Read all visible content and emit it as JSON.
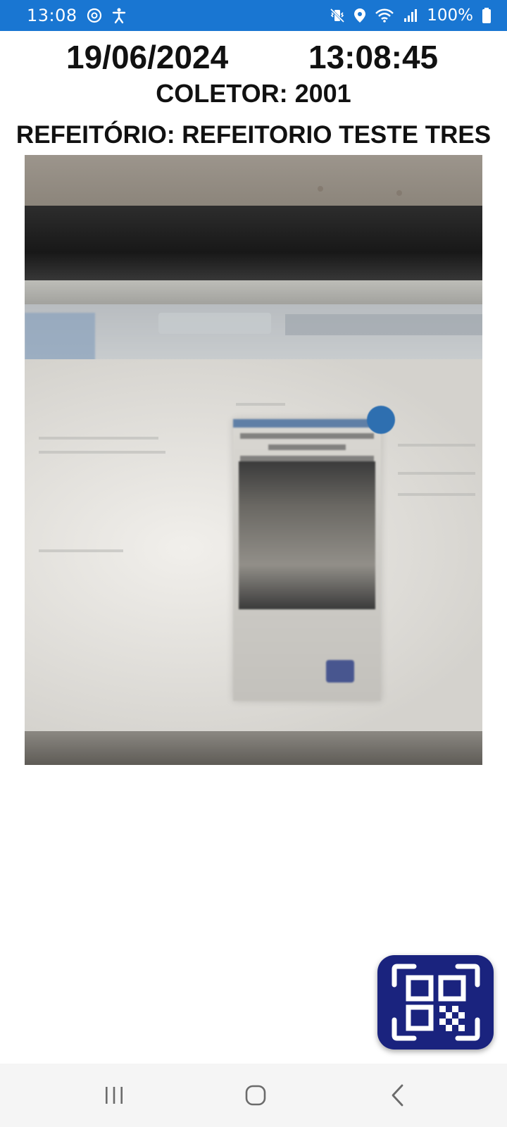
{
  "status_bar": {
    "time": "13:08",
    "battery": "100%",
    "background_color": "#1976d2",
    "icons_left": [
      "sync-icon",
      "accessibility-icon"
    ],
    "icons_right": [
      "vibrate-icon",
      "location-icon",
      "wifi-icon",
      "signal-icon",
      "battery-icon"
    ]
  },
  "header": {
    "date": "19/06/2024",
    "time": "13:08:45",
    "coletor": "COLETOR: 2001",
    "refeitorio": "REFEITÓRIO: REFEITORIO TESTE TRES"
  },
  "camera_preview": {
    "description_icon": "camera-preview"
  },
  "qr_button": {
    "icon": "qr-scan-icon",
    "background_color": "#1a237e"
  },
  "nav_bar": {
    "buttons": [
      "recents",
      "home",
      "back"
    ]
  }
}
